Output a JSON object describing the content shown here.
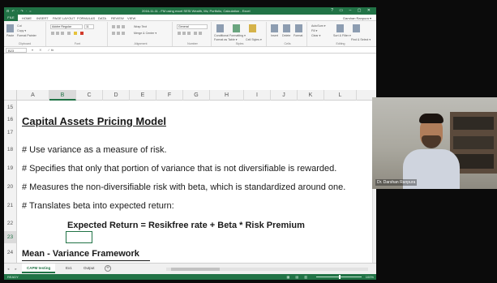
{
  "window": {
    "title": "2016-11-11 - FM using excel SESI Wealth, Mv, Portfolio, Calculation - Excel",
    "quick_access": "⊟ ↶ · ↷ · =",
    "controls": "? ▭ – ▢ ✕"
  },
  "ribbon_tabs": {
    "file": "FILE",
    "tabs": [
      "HOME",
      "INSERT",
      "PAGE LAYOUT",
      "FORMULAS",
      "DATA",
      "REVIEW",
      "VIEW"
    ],
    "user": "Darshan Ranpura ▾"
  },
  "ribbon": {
    "clipboard": {
      "paste": "Paste",
      "cut": "Cut",
      "copy": "Copy ▾",
      "format_painter": "Format Painter",
      "label": "Clipboard"
    },
    "font": {
      "name": "Adobe Regular",
      "size": "11",
      "label": "Font"
    },
    "alignment": {
      "wrap": "Wrap Text",
      "merge": "Merge & Center ▾",
      "label": "Alignment"
    },
    "number": {
      "format": "General",
      "label": "Number"
    },
    "styles": {
      "conditional": "Conditional Formatting ▾",
      "format_table": "Format as Table ▾",
      "cell_styles": "Cell Styles ▾",
      "label": "Styles"
    },
    "cells": {
      "insert": "Insert",
      "delete": "Delete",
      "format": "Format",
      "label": "Cells"
    },
    "editing": {
      "autosum": "AutoSum ▾",
      "fill": "Fill ▾",
      "clear": "Clear ▾",
      "sort": "Sort & Filter ▾",
      "find": "Find & Select ▾",
      "label": "Editing"
    }
  },
  "formula_bar": {
    "name_box": "B23",
    "buttons": "▾ ✕ ✓",
    "fx": "fx",
    "value": ""
  },
  "columns": [
    "A",
    "B",
    "C",
    "D",
    "E",
    "F",
    "G",
    "H",
    "I",
    "J",
    "K",
    "L"
  ],
  "selected_column": "B",
  "rows": [
    "15",
    "16",
    "17",
    "18",
    "19",
    "20",
    "21",
    "22",
    "23",
    "24"
  ],
  "selected_row": "23",
  "content": {
    "heading": "Capital Assets Pricing Model",
    "bullets": [
      "# Use variance as a measure of risk.",
      "# Specifies that only that portion of variance that is not diversifiable is rewarded.",
      "# Measures the non-diversifiable risk with beta, which is standardized around one.",
      "# Translates beta into expected return:"
    ],
    "formula": "Expected Return = Resikfree rate + Beta * Risk Premium",
    "heading2": "Mean - Variance Framework"
  },
  "sheet_tabs": {
    "nav": "◂ ▸",
    "tabs": [
      "CAPM testing",
      "Ex1",
      "Output"
    ],
    "active": "CAPM testing",
    "add": "+"
  },
  "status": {
    "ready": "READY",
    "views": "▦ ▤ ▥",
    "zoom": "100%",
    "zoom_level_percent": 100
  },
  "webcam": {
    "name": "Dr. Darshan Ranpura"
  }
}
